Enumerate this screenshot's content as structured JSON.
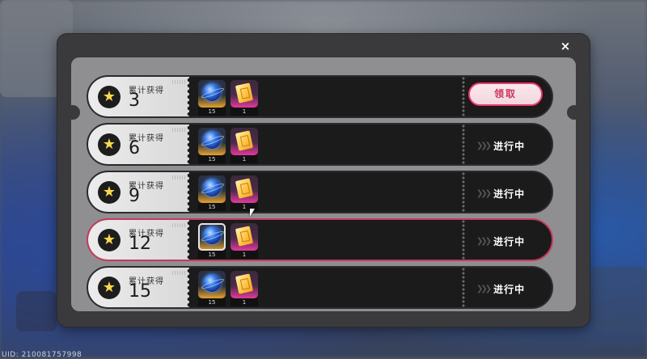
{
  "footer": {
    "uid": "UID: 210081757998"
  },
  "modal": {
    "close_icon": "×",
    "cumulative_label": "累计获得",
    "claim_label": "领取",
    "in_progress_label": "进行中",
    "rewards": [
      {
        "count": "3",
        "items": [
          {
            "icon": "blue-orb-icon",
            "qty": "15"
          },
          {
            "icon": "gold-ticket-icon",
            "qty": "1"
          }
        ],
        "status": "claim"
      },
      {
        "count": "6",
        "items": [
          {
            "icon": "blue-orb-icon",
            "qty": "15"
          },
          {
            "icon": "gold-ticket-icon",
            "qty": "1"
          }
        ],
        "status": "in_progress"
      },
      {
        "count": "9",
        "items": [
          {
            "icon": "blue-orb-icon",
            "qty": "15"
          },
          {
            "icon": "gold-ticket-icon",
            "qty": "1"
          }
        ],
        "status": "in_progress"
      },
      {
        "count": "12",
        "items": [
          {
            "icon": "blue-orb-icon",
            "qty": "15"
          },
          {
            "icon": "gold-ticket-icon",
            "qty": "1"
          }
        ],
        "status": "in_progress",
        "highlighted": true
      },
      {
        "count": "15",
        "items": [
          {
            "icon": "blue-orb-icon",
            "qty": "15"
          },
          {
            "icon": "gold-ticket-icon",
            "qty": "1"
          }
        ],
        "status": "in_progress"
      }
    ]
  },
  "colors": {
    "accent": "#c8385e",
    "star": "#ffd84a",
    "gold_frame": "#e6a22e",
    "pink_frame": "#e23a9c"
  }
}
